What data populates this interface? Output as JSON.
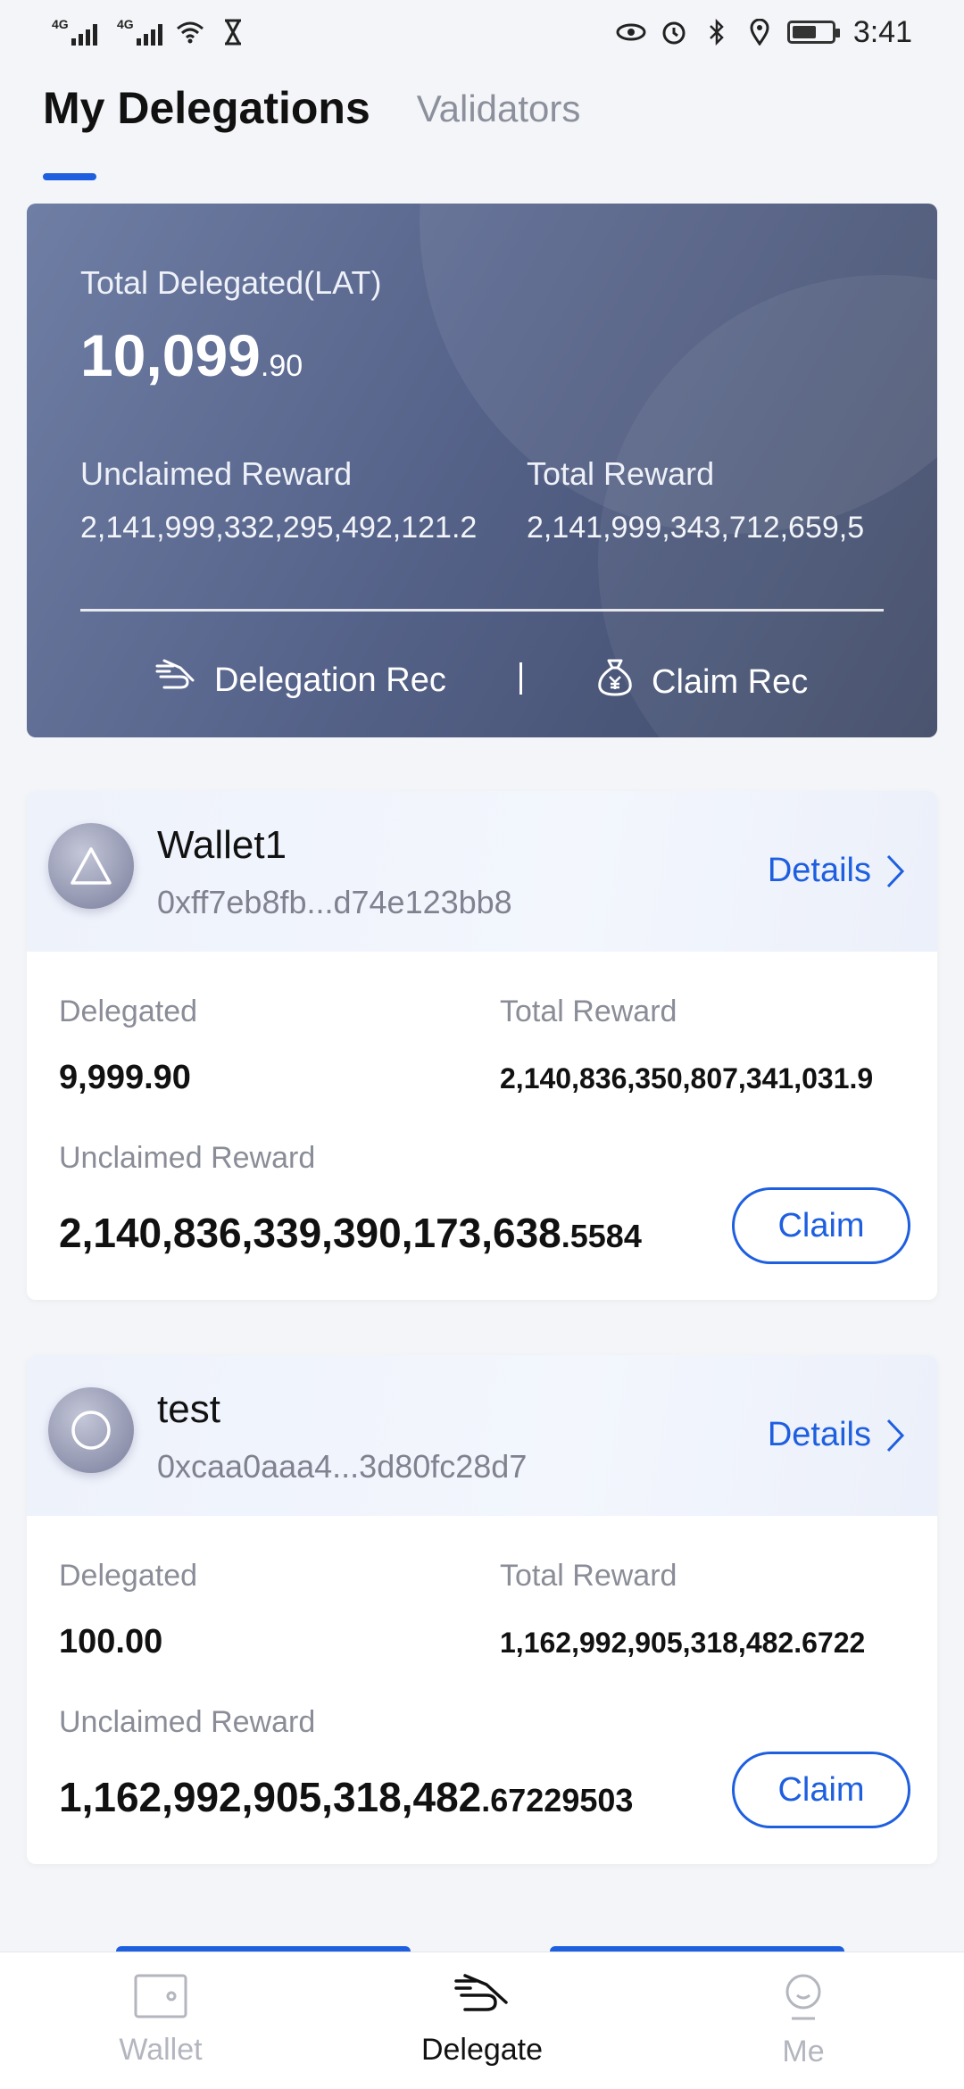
{
  "status_bar": {
    "network1": "4G",
    "network2": "4G",
    "time": "3:41"
  },
  "tabs": {
    "active": "My Delegations",
    "inactive": "Validators"
  },
  "summary": {
    "total_label": "Total Delegated(LAT)",
    "total_int": "10,099",
    "total_dec": ".90",
    "unclaimed_label": "Unclaimed Reward",
    "unclaimed_value": "2,141,999,332,295,492,121.2",
    "total_reward_label": "Total Reward",
    "total_reward_value": "2,141,999,343,712,659,5",
    "delegation_rec": "Delegation Rec",
    "claim_rec": "Claim Rec"
  },
  "delegations": [
    {
      "name": "Wallet1",
      "address": "0xff7eb8fb...d74e123bb8",
      "details": "Details",
      "delegated_label": "Delegated",
      "delegated_value": "9,999.90",
      "total_reward_label": "Total Reward",
      "total_reward_value": "2,140,836,350,807,341,031.9",
      "unclaimed_label": "Unclaimed Reward",
      "unclaimed_int": "2,140,836,339,390,173,638",
      "unclaimed_dec": ".5584",
      "claim": "Claim"
    },
    {
      "name": "test",
      "address": "0xcaa0aaa4...3d80fc28d7",
      "details": "Details",
      "delegated_label": "Delegated",
      "delegated_value": "100.00",
      "total_reward_label": "Total Reward",
      "total_reward_value": "1,162,992,905,318,482.6722",
      "unclaimed_label": "Unclaimed Reward",
      "unclaimed_int": "1,162,992,905,318,482",
      "unclaimed_dec": ".67229503",
      "claim": "Claim"
    }
  ],
  "nav": {
    "wallet": "Wallet",
    "delegate": "Delegate",
    "me": "Me"
  },
  "colors": {
    "accent": "#1e5fe0",
    "card_gradient_start": "#6f7ea4",
    "card_gradient_end": "#3f4a67"
  }
}
